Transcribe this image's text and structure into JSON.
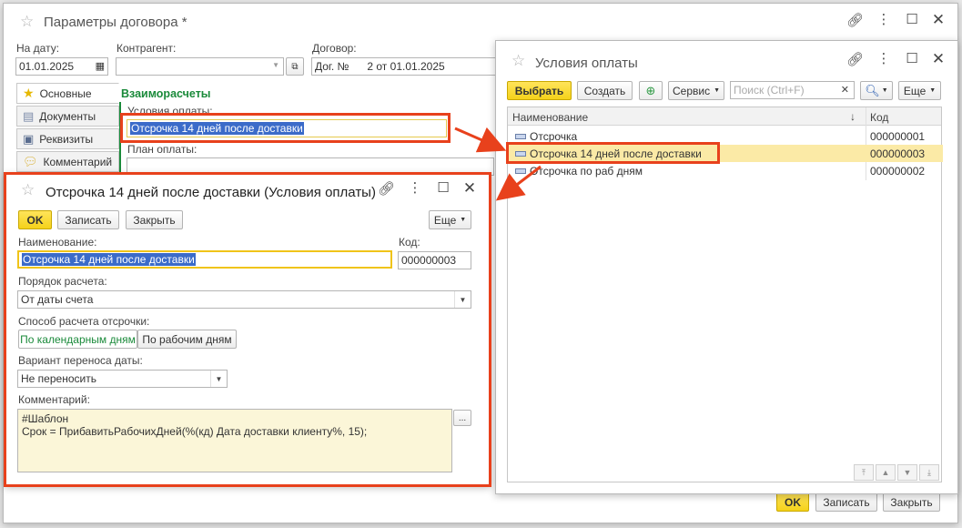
{
  "main_window": {
    "title": "Параметры договора *",
    "date_label": "На дату:",
    "date_value": "01.01.2025",
    "counterparty_label": "Контрагент:",
    "counterparty_value": "",
    "contract_label": "Договор:",
    "contract_value_prefix": "Дог. №",
    "contract_value_suffix": "2 от 01.01.2025",
    "tabs": [
      {
        "label": "Основные",
        "icon": "star-icon"
      },
      {
        "label": "Документы",
        "icon": "document-icon"
      },
      {
        "label": "Реквизиты",
        "icon": "card-icon"
      },
      {
        "label": "Комментарий",
        "icon": "comment-icon"
      }
    ],
    "section_title": "Взаиморасчеты",
    "payment_terms_label": "Условия оплаты:",
    "payment_terms_value": "Отсрочка 14 дней после доставки",
    "payment_plan_label": "План оплаты:",
    "ok_label": "OK",
    "save_label": "Записать",
    "close_label": "Закрыть"
  },
  "conditions_window": {
    "title": "Условия оплаты",
    "select_label": "Выбрать",
    "create_label": "Создать",
    "service_label": "Сервис",
    "search_placeholder": "Поиск (Ctrl+F)",
    "more_label": "Еще",
    "columns": {
      "name": "Наименование",
      "code": "Код"
    },
    "rows": [
      {
        "name": "Отсрочка",
        "code": "000000001",
        "selected": false
      },
      {
        "name": "Отсрочка 14 дней после доставки",
        "code": "000000003",
        "selected": true
      },
      {
        "name": "Отсрочка по раб дням",
        "code": "000000002",
        "selected": false
      }
    ]
  },
  "item_window": {
    "title": "Отсрочка 14 дней после доставки (Условия оплаты)",
    "ok_label": "OK",
    "save_label": "Записать",
    "close_label": "Закрыть",
    "more_label": "Еще",
    "name_label": "Наименование:",
    "name_value": "Отсрочка 14 дней после доставки",
    "code_label": "Код:",
    "code_value": "000000003",
    "order_label": "Порядок расчета:",
    "order_value": "От даты счета",
    "method_label": "Способ расчета отсрочки:",
    "method_options": [
      "По календарным дням",
      "По рабочим дням"
    ],
    "method_selected": "По календарным дням",
    "transfer_label": "Вариант переноса даты:",
    "transfer_value": "Не переносить",
    "comment_label": "Комментарий:",
    "comment_line1": "#Шаблон",
    "comment_line2": "Срок = ПрибавитьРабочихДней(%(кд) Дата доставки клиенту%, 15);"
  },
  "colors": {
    "accent_yellow": "#f5d21a",
    "selection_blue": "#3b6bc9",
    "highlight_red": "#e8411c",
    "section_green": "#1a8a3a"
  }
}
